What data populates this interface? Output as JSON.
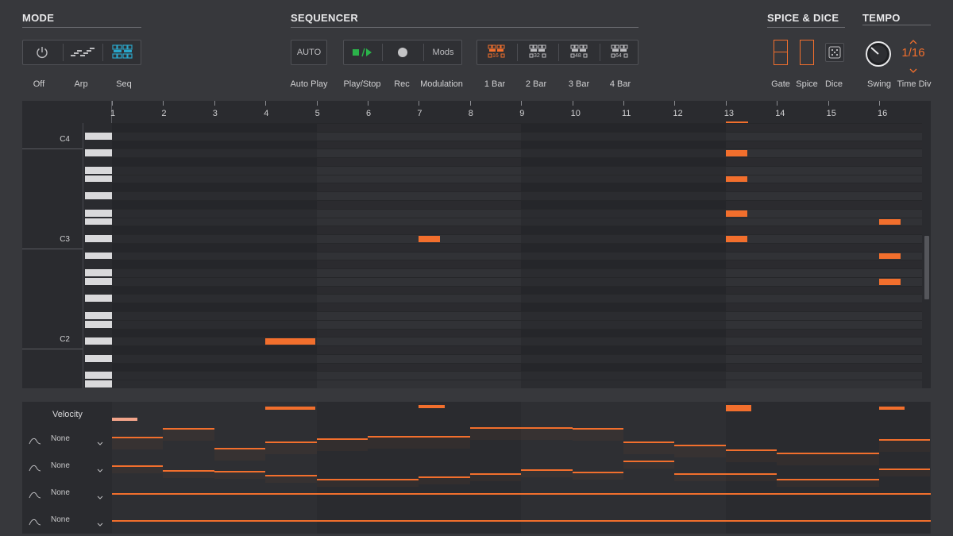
{
  "mode": {
    "title": "MODE",
    "labels": [
      "Off",
      "Arp",
      "Seq"
    ],
    "icons": [
      "power-icon",
      "arp-icon",
      "seq-grid-icon"
    ],
    "active_color": "#2aa6c9"
  },
  "sequencer": {
    "title": "SEQUENCER",
    "auto_label": "AUTO",
    "mods_label": "Mods",
    "labels": [
      "Auto Play",
      "Play/Stop",
      "Rec",
      "Modulation",
      "1 Bar",
      "2 Bar",
      "3 Bar",
      "4 Bar"
    ],
    "bar_badges": [
      "16",
      "32",
      "48",
      "64"
    ],
    "play_color": "#2bb34a"
  },
  "spice": {
    "title": "SPICE & DICE",
    "labels": [
      "Gate",
      "Spice",
      "Dice"
    ]
  },
  "tempo": {
    "title": "TEMPO",
    "labels": [
      "Swing",
      "Time Div"
    ],
    "time_div_value": "1/16"
  },
  "ruler": {
    "steps": [
      "1",
      "2",
      "3",
      "4",
      "5",
      "6",
      "7",
      "8",
      "9",
      "10",
      "11",
      "12",
      "13",
      "14",
      "15",
      "16"
    ]
  },
  "piano": {
    "notes": [
      "C4",
      "C3",
      "C2"
    ]
  },
  "mod_lanes": {
    "title": "Velocity",
    "lanes": [
      "None",
      "None",
      "None",
      "None"
    ]
  },
  "colors": {
    "accent": "#f26f2d",
    "background": "#37383c",
    "panel": "#2a2b2f"
  }
}
